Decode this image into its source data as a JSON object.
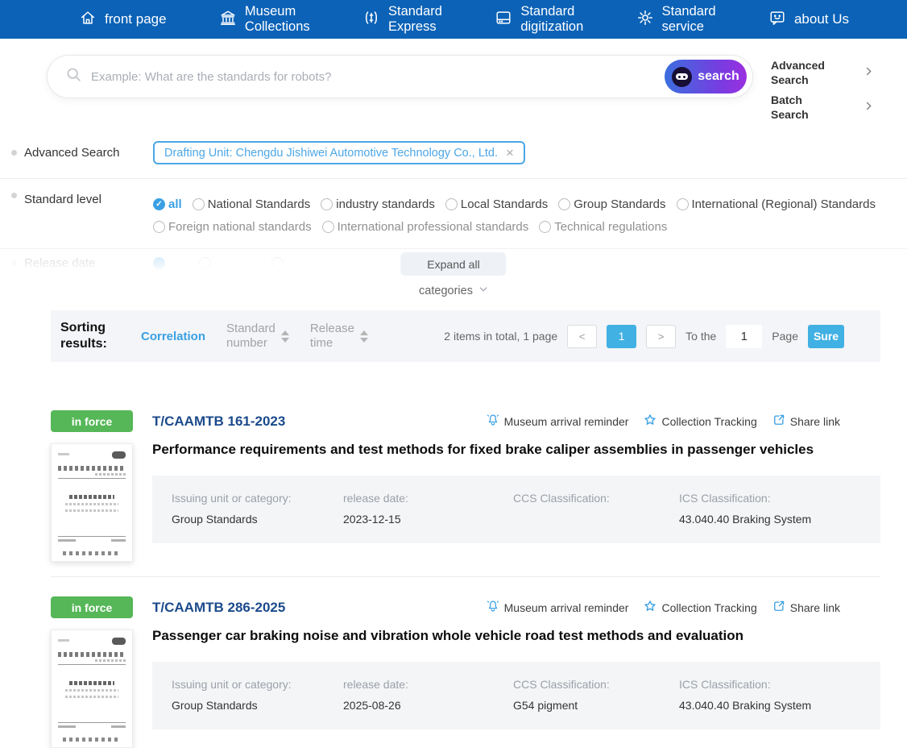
{
  "colors": {
    "nav_blue": "#0b62b7",
    "accent_blue": "#3aa0e3",
    "tag_blue": "#4da7e6",
    "badge_green": "#55b757",
    "code_blue": "#1b4a8b",
    "button_blue": "#41b0e3",
    "search_gradient_start": "#3b6ede",
    "search_gradient_end": "#9b2fe0"
  },
  "icons": {
    "close": "×",
    "check": "✓"
  },
  "nav": {
    "items": [
      {
        "label": "front page",
        "icon": "home-icon"
      },
      {
        "label": "Museum Collections",
        "icon": "museum-icon"
      },
      {
        "label": "Standard Express",
        "icon": "express-icon"
      },
      {
        "label": "Standard digitization",
        "icon": "digitization-icon"
      },
      {
        "label": "Standard service",
        "icon": "service-gear-icon"
      },
      {
        "label": "about Us",
        "icon": "chat-smiley-icon"
      }
    ]
  },
  "search": {
    "placeholder": "Example: What are the standards for robots?",
    "button": "search",
    "advanced": "Advanced Search",
    "batch": "Batch Search"
  },
  "filters": {
    "advanced_label": "Advanced Search",
    "tag": "Drafting Unit: Chengdu Jishiwei Automotive Technology Co., Ltd.",
    "level_label": "Standard level",
    "levels_row1": [
      "all",
      "National Standards",
      "industry standards",
      "Local Standards",
      "Group Standards",
      "International (Regional) Standards"
    ],
    "levels_row2": [
      "Foreign national standards",
      "International professional standards",
      "Technical regulations"
    ],
    "selected_level": "all",
    "release_label": "Release date",
    "expand_button": "Expand all",
    "categories": "categories"
  },
  "sorting": {
    "label": "Sorting results:",
    "correlation": "Correlation",
    "standard_number": "Standard number",
    "release_time": "Release time",
    "total": "2 items in total, 1 page",
    "prev": "<",
    "page": "1",
    "next": ">",
    "to_the": "To the",
    "goto": "1",
    "page_word": "Page",
    "sure": "Sure"
  },
  "result_labels": {
    "status": "in force",
    "actions": [
      "Museum arrival reminder",
      "Collection Tracking",
      "Share link"
    ],
    "issuing": "Issuing unit or category:",
    "release": "release date:",
    "ccs": "CCS Classification:",
    "ics": "ICS Classification:"
  },
  "results": [
    {
      "code": "T/CAAMTB 161-2023",
      "title": "Performance requirements and test methods for fixed brake caliper assemblies in passenger vehicles",
      "issuing": "Group Standards",
      "release_date": "2023-12-15",
      "ccs": "",
      "ics": "43.040.40 Braking System"
    },
    {
      "code": "T/CAAMTB 286-2025",
      "title": "Passenger car braking noise and vibration whole vehicle road test methods and evaluation",
      "issuing": "Group Standards",
      "release_date": "2025-08-26",
      "ccs": "G54 pigment",
      "ics": "43.040.40 Braking System"
    }
  ]
}
